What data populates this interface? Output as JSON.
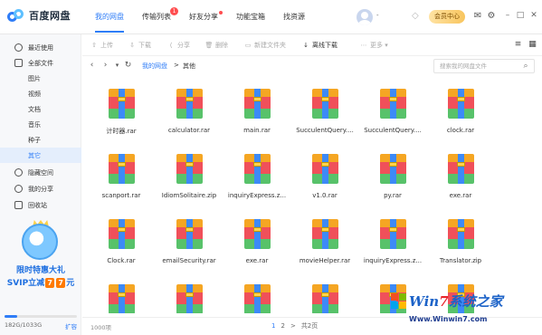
{
  "app": {
    "logo_text": "百度网盘"
  },
  "nav": [
    {
      "label": "我的网盘",
      "active": true
    },
    {
      "label": "传输列表",
      "badge": "1"
    },
    {
      "label": "好友分享",
      "dot": true
    },
    {
      "label": "功能宝箱"
    },
    {
      "label": "找资源"
    }
  ],
  "header": {
    "username": "-",
    "vip_label": "会员中心"
  },
  "sidebar": {
    "items": [
      {
        "label": "最近使用",
        "icon": "clock-icon"
      },
      {
        "label": "全部文件",
        "icon": "document-icon"
      },
      {
        "label": "图片",
        "sub": true
      },
      {
        "label": "视频",
        "sub": true
      },
      {
        "label": "文档",
        "sub": true
      },
      {
        "label": "音乐",
        "sub": true
      },
      {
        "label": "种子",
        "sub": true
      },
      {
        "label": "其它",
        "sub": true,
        "active": true
      },
      {
        "label": "隐藏空间",
        "icon": "lock-icon"
      },
      {
        "label": "我的分享",
        "icon": "share-icon"
      },
      {
        "label": "回收站",
        "icon": "trash-icon"
      }
    ],
    "promo": {
      "line1": "限时特惠大礼",
      "line2_prefix": "SVIP立减",
      "digit1": "7",
      "digit2": "7",
      "line2_suffix": "元"
    },
    "storage": {
      "text": "182G/1033G",
      "used_fraction": 0.176,
      "expand_label": "扩容"
    }
  },
  "toolbar": {
    "upload": "上传",
    "download": "下载",
    "share": "分享",
    "delete": "删除",
    "new_folder": "新建文件夹",
    "offline_download": "离线下载",
    "more": "更多"
  },
  "pathbar": {
    "root": "我的网盘",
    "separator": ">",
    "current": "其他",
    "search_placeholder": "搜索我的网盘文件"
  },
  "files": [
    "计时器.rar",
    "calculator.rar",
    "main.rar",
    "SucculentQuery....",
    "SucculentQuery....",
    "clock.rar",
    "scanport.rar",
    "IdiomSolitaire.zip",
    "inquiryExpress.z...",
    "v1.0.rar",
    "py.rar",
    "exe.rar",
    "Clock.rar",
    "emailSecurity.rar",
    "exe.rar",
    "movieHelper.rar",
    "inquiryExpress.z...",
    "Translator.zip",
    "",
    "",
    "",
    "",
    "",
    ""
  ],
  "status": {
    "count": "1000项",
    "page1": "1",
    "page2": "2",
    "next": ">",
    "total_pages": "共2页"
  },
  "watermark": {
    "brand_prefix": "Win",
    "brand_seven": "7",
    "brand_suffix": "系统之家",
    "url": "Www.Winwin7.com"
  },
  "colors": {
    "accent": "#2f7df7",
    "badge": "#ff4d4f"
  }
}
